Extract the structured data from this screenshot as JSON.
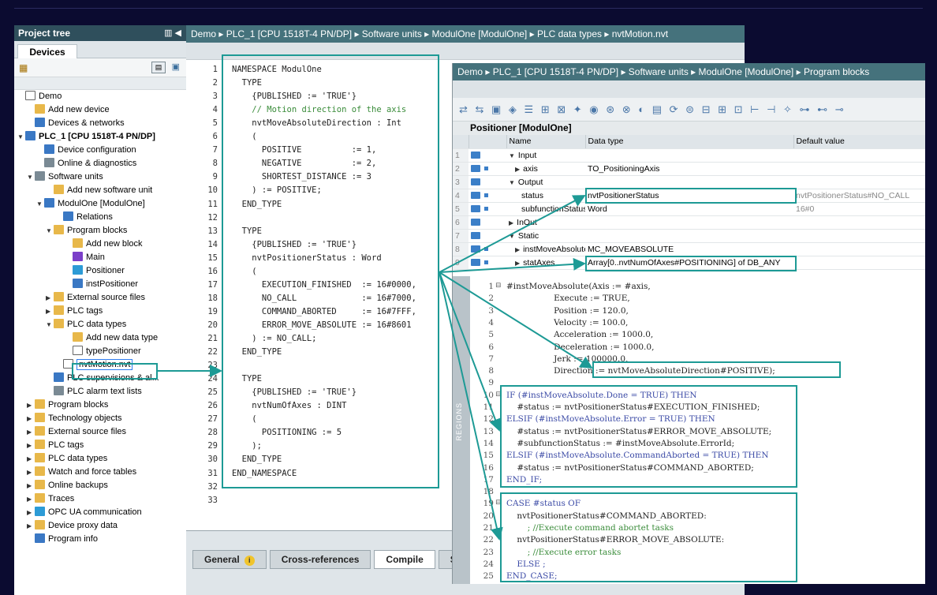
{
  "tree": {
    "title": "Project tree",
    "tab": "Devices",
    "items": [
      {
        "label": "Demo",
        "depth": 0,
        "arrow": "",
        "icon": "w"
      },
      {
        "label": "Add new device",
        "depth": 1,
        "arrow": "",
        "icon": "y"
      },
      {
        "label": "Devices & networks",
        "depth": 1,
        "arrow": "",
        "icon": "b"
      },
      {
        "label": "PLC_1 [CPU 1518T-4 PN/DP]",
        "depth": 0,
        "arrow": "▼",
        "icon": "b",
        "bold": true
      },
      {
        "label": "Device configuration",
        "depth": 2,
        "arrow": "",
        "icon": "b"
      },
      {
        "label": "Online & diagnostics",
        "depth": 2,
        "arrow": "",
        "icon": "g"
      },
      {
        "label": "Software units",
        "depth": 1,
        "arrow": "▼",
        "icon": "g"
      },
      {
        "label": "Add new software unit",
        "depth": 3,
        "arrow": "",
        "icon": "y"
      },
      {
        "label": "ModulOne [ModulOne]",
        "depth": 2,
        "arrow": "▼",
        "icon": "b"
      },
      {
        "label": "Relations",
        "depth": 4,
        "arrow": "",
        "icon": "b"
      },
      {
        "label": "Program blocks",
        "depth": 3,
        "arrow": "▼",
        "icon": "y"
      },
      {
        "label": "Add new block",
        "depth": 5,
        "arrow": "",
        "icon": "y"
      },
      {
        "label": "Main",
        "depth": 5,
        "arrow": "",
        "icon": "p"
      },
      {
        "label": "Positioner",
        "depth": 5,
        "arrow": "",
        "icon": "c"
      },
      {
        "label": "instPositioner",
        "depth": 5,
        "arrow": "",
        "icon": "b"
      },
      {
        "label": "External source files",
        "depth": 3,
        "arrow": "▶",
        "icon": "y"
      },
      {
        "label": "PLC tags",
        "depth": 3,
        "arrow": "▶",
        "icon": "y"
      },
      {
        "label": "PLC data types",
        "depth": 3,
        "arrow": "▼",
        "icon": "y"
      },
      {
        "label": "Add new data type",
        "depth": 5,
        "arrow": "",
        "icon": "y"
      },
      {
        "label": "typePositioner",
        "depth": 5,
        "arrow": "",
        "icon": "w"
      },
      {
        "label": "nvtMotion.nvt",
        "depth": 4,
        "arrow": "",
        "icon": "w",
        "selected": true
      },
      {
        "label": "PLC supervisions & al...",
        "depth": 3,
        "arrow": "",
        "icon": "b"
      },
      {
        "label": "PLC alarm text lists",
        "depth": 3,
        "arrow": "",
        "icon": "g"
      },
      {
        "label": "Program blocks",
        "depth": 1,
        "arrow": "▶",
        "icon": "y"
      },
      {
        "label": "Technology objects",
        "depth": 1,
        "arrow": "▶",
        "icon": "y"
      },
      {
        "label": "External source files",
        "depth": 1,
        "arrow": "▶",
        "icon": "y"
      },
      {
        "label": "PLC tags",
        "depth": 1,
        "arrow": "▶",
        "icon": "y"
      },
      {
        "label": "PLC data types",
        "depth": 1,
        "arrow": "▶",
        "icon": "y"
      },
      {
        "label": "Watch and force tables",
        "depth": 1,
        "arrow": "▶",
        "icon": "y"
      },
      {
        "label": "Online backups",
        "depth": 1,
        "arrow": "▶",
        "icon": "y"
      },
      {
        "label": "Traces",
        "depth": 1,
        "arrow": "▶",
        "icon": "y"
      },
      {
        "label": "OPC UA communication",
        "depth": 1,
        "arrow": "▶",
        "icon": "c"
      },
      {
        "label": "Device proxy data",
        "depth": 1,
        "arrow": "▶",
        "icon": "y"
      },
      {
        "label": "Program info",
        "depth": 1,
        "arrow": "",
        "icon": "b"
      }
    ]
  },
  "ns_editor": {
    "breadcrumb": "Demo  ▸  PLC_1 [CPU 1518T-4 PN/DP]  ▸  Software units  ▸  ModulOne [ModulOne]  ▸  PLC data types  ▸  nvtMotion.nvt",
    "lines": [
      "NAMESPACE ModulOne",
      "  TYPE",
      "    {PUBLISHED := 'TRUE'}",
      "    // Motion direction of the axis",
      "    nvtMoveAbsoluteDirection : Int",
      "    (",
      "      POSITIVE          := 1,",
      "      NEGATIVE          := 2,",
      "      SHORTEST_DISTANCE := 3",
      "    ) := POSITIVE;",
      "  END_TYPE",
      "",
      "  TYPE",
      "    {PUBLISHED := 'TRUE'}",
      "    nvtPositionerStatus : Word",
      "    (",
      "      EXECUTION_FINISHED  := 16#0000,",
      "      NO_CALL             := 16#7000,",
      "      COMMAND_ABORTED     := 16#7FFF,",
      "      ERROR_MOVE_ABSOLUTE := 16#8601",
      "    ) := NO_CALL;",
      "  END_TYPE",
      "",
      "  TYPE",
      "    {PUBLISHED := 'TRUE'}",
      "    nvtNumOfAxes : DINT",
      "    (",
      "      POSITIONING := 5",
      "    );",
      "  END_TYPE",
      "END_NAMESPACE",
      "",
      ""
    ],
    "tabs": [
      "General",
      "Cross-references",
      "Compile",
      "Synta"
    ]
  },
  "pb_editor": {
    "breadcrumb": "Demo  ▸  PLC_1 [CPU 1518T-4 PN/DP]  ▸  Software units  ▸  ModulOne [ModulOne]  ▸  Program blocks",
    "block_name": "Positioner [ModulOne]",
    "columns": [
      "Name",
      "Data type",
      "Default value"
    ],
    "rows": [
      {
        "num": "1",
        "name": "Input",
        "type": "",
        "def": "",
        "arrow": "▼",
        "indent": 0,
        "sq": false
      },
      {
        "num": "2",
        "name": "axis",
        "type": "TO_PositioningAxis",
        "def": "",
        "arrow": "▶",
        "indent": 1,
        "sq": true
      },
      {
        "num": "3",
        "name": "Output",
        "type": "",
        "def": "",
        "arrow": "▼",
        "indent": 0,
        "sq": false
      },
      {
        "num": "4",
        "name": "status",
        "type": "nvtPositionerStatus",
        "def": "nvtPositionerStatus#NO_CALL",
        "arrow": "",
        "indent": 2,
        "sq": true
      },
      {
        "num": "5",
        "name": "subfunctionStatus",
        "type": "Word",
        "def": "16#0",
        "arrow": "",
        "indent": 2,
        "sq": true
      },
      {
        "num": "6",
        "name": "InOut",
        "type": "",
        "def": "",
        "arrow": "▶",
        "indent": 0,
        "sq": false
      },
      {
        "num": "7",
        "name": "Static",
        "type": "",
        "def": "",
        "arrow": "▼",
        "indent": 0,
        "sq": false
      },
      {
        "num": "8",
        "name": "instMoveAbsolute",
        "type": "MC_MOVEABSOLUTE",
        "def": "",
        "arrow": "▶",
        "indent": 1,
        "sq": true
      },
      {
        "num": "9",
        "name": "statAxes",
        "type": "Array[0..nvtNumOfAxes#POSITIONING] of DB_ANY",
        "def": "",
        "arrow": "▶",
        "indent": 1,
        "sq": true
      }
    ],
    "regions_label": "REGIONS",
    "code": [
      {
        "n": "1",
        "fold": "⊟",
        "t": "#instMoveAbsolute(Axis := #axis,"
      },
      {
        "n": "2",
        "fold": "",
        "t": "                  Execute := TRUE,"
      },
      {
        "n": "3",
        "fold": "",
        "t": "                  Position := 120.0,"
      },
      {
        "n": "4",
        "fold": "",
        "t": "                  Velocity := 100.0,"
      },
      {
        "n": "5",
        "fold": "",
        "t": "                  Acceleration := 1000.0,"
      },
      {
        "n": "6",
        "fold": "",
        "t": "                  Deceleration := 1000.0,"
      },
      {
        "n": "7",
        "fold": "",
        "t": "                  Jerk := 100000.0,"
      },
      {
        "n": "8",
        "fold": "",
        "t": "                  Direction := nvtMoveAbsoluteDirection#POSITIVE);"
      },
      {
        "n": "9",
        "fold": "",
        "t": ""
      },
      {
        "n": "10",
        "fold": "⊟",
        "t": "IF (#instMoveAbsolute.Done = TRUE) THEN"
      },
      {
        "n": "11",
        "fold": "",
        "t": "    #status := nvtPositionerStatus#EXECUTION_FINISHED;"
      },
      {
        "n": "12",
        "fold": "",
        "t": "ELSIF (#instMoveAbsolute.Error = TRUE) THEN"
      },
      {
        "n": "13",
        "fold": "",
        "t": "    #status := nvtPositionerStatus#ERROR_MOVE_ABSOLUTE;"
      },
      {
        "n": "14",
        "fold": "",
        "t": "    #subfunctionStatus := #instMoveAbsolute.ErrorId;"
      },
      {
        "n": "15",
        "fold": "",
        "t": "ELSIF (#instMoveAbsolute.CommandAborted = TRUE) THEN"
      },
      {
        "n": "16",
        "fold": "",
        "t": "    #status := nvtPositionerStatus#COMMAND_ABORTED;"
      },
      {
        "n": "17",
        "fold": "",
        "t": "END_IF;"
      },
      {
        "n": "18",
        "fold": "",
        "t": ""
      },
      {
        "n": "19",
        "fold": "⊟",
        "t": "CASE #status OF"
      },
      {
        "n": "20",
        "fold": "",
        "t": "    nvtPositionerStatus#COMMAND_ABORTED:"
      },
      {
        "n": "21",
        "fold": "",
        "t": "        ; //Execute command abortet tasks"
      },
      {
        "n": "22",
        "fold": "",
        "t": "    nvtPositionerStatus#ERROR_MOVE_ABSOLUTE:"
      },
      {
        "n": "23",
        "fold": "",
        "t": "        ; //Execute error tasks"
      },
      {
        "n": "24",
        "fold": "",
        "t": "    ELSE ;"
      },
      {
        "n": "25",
        "fold": "",
        "t": "END_CASE;"
      }
    ]
  },
  "colors": {
    "highlight": "#1d9a95",
    "header": "#2f4f5c",
    "breadcrumb": "#45727c",
    "background": "#0b0b30"
  }
}
